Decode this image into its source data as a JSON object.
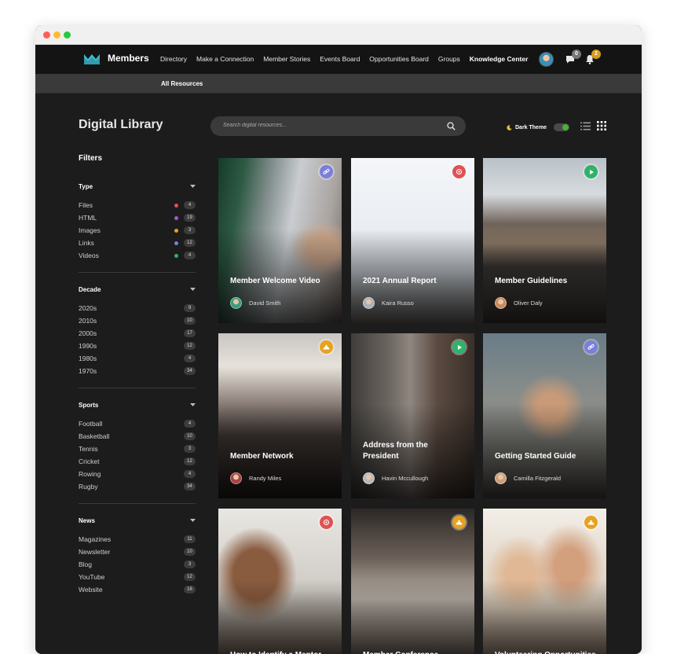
{
  "app": {
    "name": "Members"
  },
  "nav": {
    "links": [
      "Directory",
      "Make a Connection",
      "Member Stories",
      "Events Board",
      "Opportunities Board",
      "Groups",
      "Knowledge Center"
    ],
    "active": "Knowledge Center",
    "chat_count": "0",
    "notification_count": "2"
  },
  "subnav": {
    "label": "All Resources"
  },
  "page": {
    "title": "Digital Library"
  },
  "search": {
    "placeholder": "Search digital resources..."
  },
  "theme": {
    "label": "Dark Theme",
    "enabled": true
  },
  "filters": {
    "title": "Filters",
    "groups": [
      {
        "name": "Type",
        "items": [
          {
            "label": "Files",
            "count": "4",
            "color": "#e05252"
          },
          {
            "label": "HTML",
            "count": "19",
            "color": "#b24fd6"
          },
          {
            "label": "Images",
            "count": "3",
            "color": "#e6a321"
          },
          {
            "label": "Links",
            "count": "12",
            "color": "#7a7fdc"
          },
          {
            "label": "Videos",
            "count": "4",
            "color": "#2fb36a"
          }
        ]
      },
      {
        "name": "Decade",
        "items": [
          {
            "label": "2020s",
            "count": "9"
          },
          {
            "label": "2010s",
            "count": "10"
          },
          {
            "label": "2000s",
            "count": "17"
          },
          {
            "label": "1990s",
            "count": "12"
          },
          {
            "label": "1980s",
            "count": "4"
          },
          {
            "label": "1970s",
            "count": "34"
          }
        ]
      },
      {
        "name": "Sports",
        "items": [
          {
            "label": "Football",
            "count": "4"
          },
          {
            "label": "Basketball",
            "count": "10"
          },
          {
            "label": "Tennis",
            "count": "3"
          },
          {
            "label": "Cricket",
            "count": "12"
          },
          {
            "label": "Rowing",
            "count": "4"
          },
          {
            "label": "Rugby",
            "count": "34"
          }
        ]
      },
      {
        "name": "News",
        "items": [
          {
            "label": "Magazines",
            "count": "11"
          },
          {
            "label": "Newsletter",
            "count": "10"
          },
          {
            "label": "Blog",
            "count": "3"
          },
          {
            "label": "YouTube",
            "count": "12"
          },
          {
            "label": "Website",
            "count": "16"
          }
        ]
      }
    ]
  },
  "cards": [
    {
      "title": "Member Welcome Video",
      "author": "David Smith",
      "icon": "link-icon",
      "icon_color": "#7a7fdc"
    },
    {
      "title": "2021 Annual Report",
      "author": "Kaira Russo",
      "icon": "file-icon",
      "icon_color": "#e05252"
    },
    {
      "title": "Member Guidelines",
      "author": "Oliver Daly",
      "icon": "play-icon",
      "icon_color": "#2fb36a"
    },
    {
      "title": "Member Network",
      "author": "Randy Miles",
      "icon": "image-icon",
      "icon_color": "#e6a321"
    },
    {
      "title": "Address from the President",
      "author": "Havin Mccullough",
      "icon": "play-icon",
      "icon_color": "#2fb36a"
    },
    {
      "title": "Getting Started Guide",
      "author": "Camilla Fitzgerald",
      "icon": "link-icon",
      "icon_color": "#7a7fdc"
    },
    {
      "title": "How to Identify a Mentor",
      "author": "",
      "icon": "file-icon",
      "icon_color": "#e05252"
    },
    {
      "title": "Member Conference Photos",
      "author": "",
      "icon": "image-icon",
      "icon_color": "#e6a321"
    },
    {
      "title": "Volunteering Opportunities",
      "author": "",
      "icon": "image-icon",
      "icon_color": "#e6a321"
    }
  ]
}
